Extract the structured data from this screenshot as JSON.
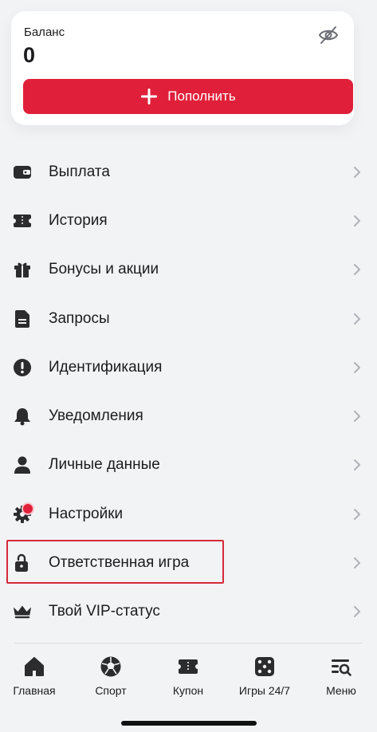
{
  "balance": {
    "label": "Баланс",
    "value": "0",
    "topup_label": "Пополнить"
  },
  "colors": {
    "accent": "#e0203a",
    "highlight": "#d52a3a",
    "icon": "#2c2c2e",
    "chevron": "#b0b2b8"
  },
  "menu": {
    "items": [
      {
        "label": "Выплата",
        "icon": "wallet-icon"
      },
      {
        "label": "История",
        "icon": "ticket-icon"
      },
      {
        "label": "Бонусы и акции",
        "icon": "gift-icon"
      },
      {
        "label": "Запросы",
        "icon": "document-icon"
      },
      {
        "label": "Идентификация",
        "icon": "exclamation-icon"
      },
      {
        "label": "Уведомления",
        "icon": "bell-icon"
      },
      {
        "label": "Личные данные",
        "icon": "person-icon"
      },
      {
        "label": "Настройки",
        "icon": "gear-icon"
      },
      {
        "label": "Ответственная игра",
        "icon": "unlock-icon"
      },
      {
        "label": "Твой VIP-статус",
        "icon": "crown-icon"
      }
    ]
  },
  "tabs": [
    {
      "label": "Главная",
      "icon": "home-icon"
    },
    {
      "label": "Спорт",
      "icon": "soccer-ball-icon"
    },
    {
      "label": "Купон",
      "icon": "coupon-icon"
    },
    {
      "label": "Игры 24/7",
      "icon": "dice-icon"
    },
    {
      "label": "Меню",
      "icon": "menu-search-icon"
    }
  ]
}
